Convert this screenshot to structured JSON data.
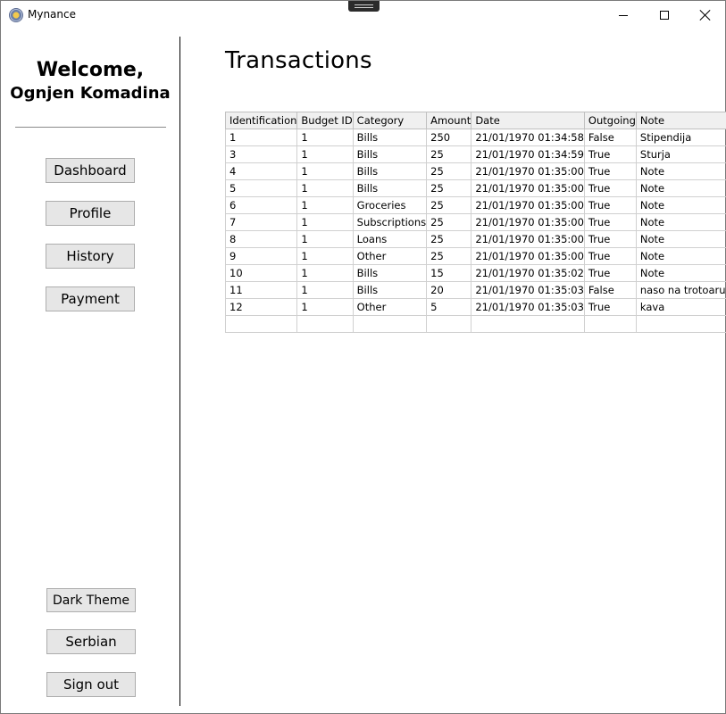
{
  "window": {
    "title": "Mynance"
  },
  "sidebar": {
    "welcome": "Welcome,",
    "user_name": "Ognjen Komadina",
    "nav": [
      "Dashboard",
      "Profile",
      "History",
      "Payment"
    ],
    "bottom": [
      "Dark Theme",
      "Serbian",
      "Sign out"
    ]
  },
  "main": {
    "heading": "Transactions",
    "table": {
      "columns": [
        "Identification",
        "Budget ID",
        "Category",
        "Amount",
        "Date",
        "Outgoing",
        "Note"
      ],
      "rows": [
        [
          "1",
          "1",
          "Bills",
          "250",
          "21/01/1970 01:34:58",
          "False",
          "Stipendija"
        ],
        [
          "3",
          "1",
          "Bills",
          "25",
          "21/01/1970 01:34:59",
          "True",
          "Sturja"
        ],
        [
          "4",
          "1",
          "Bills",
          "25",
          "21/01/1970 01:35:00",
          "True",
          "Note"
        ],
        [
          "5",
          "1",
          "Bills",
          "25",
          "21/01/1970 01:35:00",
          "True",
          "Note"
        ],
        [
          "6",
          "1",
          "Groceries",
          "25",
          "21/01/1970 01:35:00",
          "True",
          "Note"
        ],
        [
          "7",
          "1",
          "Subscriptions",
          "25",
          "21/01/1970 01:35:00",
          "True",
          "Note"
        ],
        [
          "8",
          "1",
          "Loans",
          "25",
          "21/01/1970 01:35:00",
          "True",
          "Note"
        ],
        [
          "9",
          "1",
          "Other",
          "25",
          "21/01/1970 01:35:00",
          "True",
          "Note"
        ],
        [
          "10",
          "1",
          "Bills",
          "15",
          "21/01/1970 01:35:02",
          "True",
          "Note"
        ],
        [
          "11",
          "1",
          "Bills",
          "20",
          "21/01/1970 01:35:03",
          "False",
          "naso na trotoaru"
        ],
        [
          "12",
          "1",
          "Other",
          "5",
          "21/01/1970 01:35:03",
          "True",
          "kava"
        ],
        [
          "",
          "",
          "",
          "",
          "",
          "",
          ""
        ]
      ]
    }
  }
}
